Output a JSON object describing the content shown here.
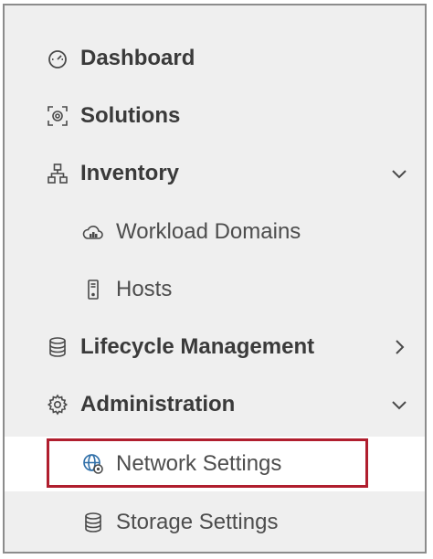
{
  "nav": {
    "items": [
      {
        "label": "Dashboard",
        "icon": "dashboard-icon"
      },
      {
        "label": "Solutions",
        "icon": "solutions-icon"
      },
      {
        "label": "Inventory",
        "icon": "inventory-icon",
        "expanded": true
      },
      {
        "label": "Workload Domains",
        "icon": "cloud-icon"
      },
      {
        "label": "Hosts",
        "icon": "host-icon"
      },
      {
        "label": "Lifecycle Management",
        "icon": "database-icon",
        "expanded": false
      },
      {
        "label": "Administration",
        "icon": "gear-icon",
        "expanded": true
      },
      {
        "label": "Network Settings",
        "icon": "network-settings-icon",
        "selected": true
      },
      {
        "label": "Storage Settings",
        "icon": "storage-icon"
      }
    ]
  },
  "colors": {
    "panel_background": "#efefef",
    "selected_background": "#ffffff",
    "highlight_border": "#b01e2e",
    "text": "#3a3a3a",
    "icon_accent_blue": "#2f6fa8"
  }
}
